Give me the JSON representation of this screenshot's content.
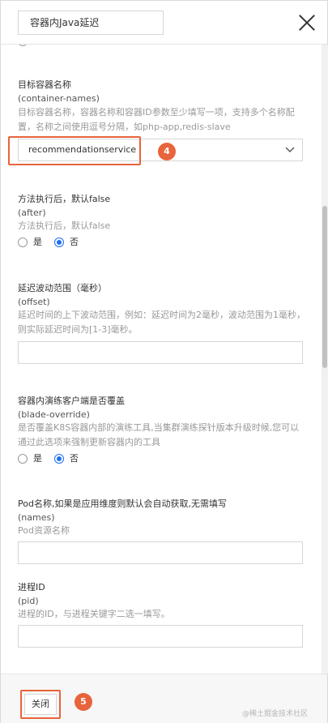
{
  "header": {
    "title": "容器内Java延迟"
  },
  "fields": {
    "container_names": {
      "title": "目标容器名称",
      "key": "(container-names)",
      "desc": "目标容器名称，容器名称和容器ID参数至少填写一项，支持多个名称配置，名称之间使用逗号分隔，如php-app,redis-slave",
      "value": "recommendationservice"
    },
    "after": {
      "title": "方法执行后，默认false",
      "key": "(after)",
      "desc": "方法执行后，默认false",
      "options": [
        "是",
        "否"
      ],
      "selected": "否"
    },
    "offset": {
      "title": "延迟波动范围（毫秒）",
      "key": "(offset)",
      "desc": "延迟时间的上下波动范围，例如：延迟时间为2毫秒，波动范围为1毫秒，则实际延迟时间为[1-3]毫秒。",
      "value": ""
    },
    "blade_override": {
      "title": "容器内演练客户端是否覆盖",
      "key": "(blade-override)",
      "desc": "是否覆盖K8S容器内部的演练工具,当集群演练探针版本升级时候,您可以通过此选项来强制更新容器内的工具",
      "options": [
        "是",
        "否"
      ],
      "selected": "否"
    },
    "names": {
      "title": "Pod名称,如果是应用维度则默认会自动获取,无需填写",
      "key": "(names)",
      "desc": "Pod资源名称",
      "value": ""
    },
    "pid": {
      "title": "进程ID",
      "key": "(pid)",
      "desc": "进程的ID，与进程关键字二选一填写。",
      "value": ""
    }
  },
  "annotations": {
    "step4": "4",
    "step5": "5"
  },
  "footer": {
    "close_label": "关闭",
    "watermark": "@稀土掘金技术社区"
  },
  "colors": {
    "accent": "#1d6ff2",
    "highlight": "#e8643c"
  }
}
